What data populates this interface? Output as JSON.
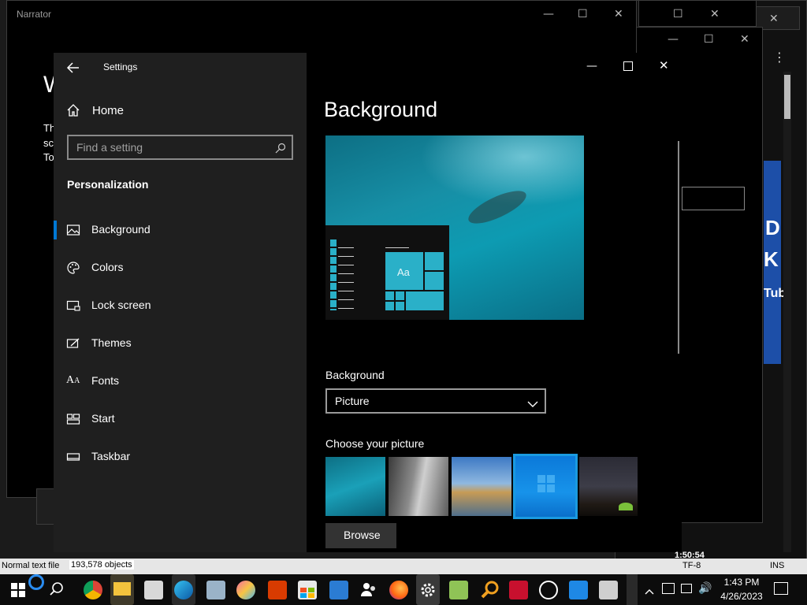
{
  "narrator": {
    "title": "Narrator",
    "heading": "W",
    "lines": [
      "Th",
      "sc",
      "To"
    ]
  },
  "settings": {
    "title": "Settings",
    "home_label": "Home",
    "search_placeholder": "Find a setting",
    "section_title": "Personalization",
    "nav": [
      {
        "label": "Background",
        "icon": "picture-icon",
        "selected": true
      },
      {
        "label": "Colors",
        "icon": "palette-icon",
        "selected": false
      },
      {
        "label": "Lock screen",
        "icon": "lock-screen-icon",
        "selected": false
      },
      {
        "label": "Themes",
        "icon": "themes-icon",
        "selected": false
      },
      {
        "label": "Fonts",
        "icon": "fonts-icon",
        "selected": false
      },
      {
        "label": "Start",
        "icon": "start-icon",
        "selected": false
      },
      {
        "label": "Taskbar",
        "icon": "taskbar-icon",
        "selected": false
      }
    ],
    "page_title": "Background",
    "preview_sample_text": "Aa",
    "background_label": "Background",
    "background_value": "Picture",
    "choose_picture_label": "Choose your picture",
    "browse_label": "Browse",
    "accent_color": "#0078d4",
    "tile_color": "#2ab0c8"
  },
  "editor_status": {
    "file_type": "Normal text file",
    "objects": "193,578 objects",
    "encoding": "TF-8",
    "mode": "INS",
    "timer": "1:50:54"
  },
  "bg_text": {
    "word1": "D",
    "word2": "K",
    "word3": "Tub"
  },
  "taskbar": {
    "time": "1:43 PM",
    "date": "4/26/2023",
    "icons": [
      "start-icon",
      "cortana-icon",
      "search-icon",
      "chrome-icon",
      "file-explorer-icon",
      "app-icon",
      "edge-icon",
      "photos-icon",
      "paint3d-icon",
      "office-icon",
      "store-icon",
      "calculator-icon",
      "people-icon",
      "firefox-icon",
      "settings-icon",
      "notepadpp-icon",
      "search-tool-icon",
      "devcpp-icon",
      "clock-icon",
      "calendar-icon",
      "book-icon"
    ]
  }
}
